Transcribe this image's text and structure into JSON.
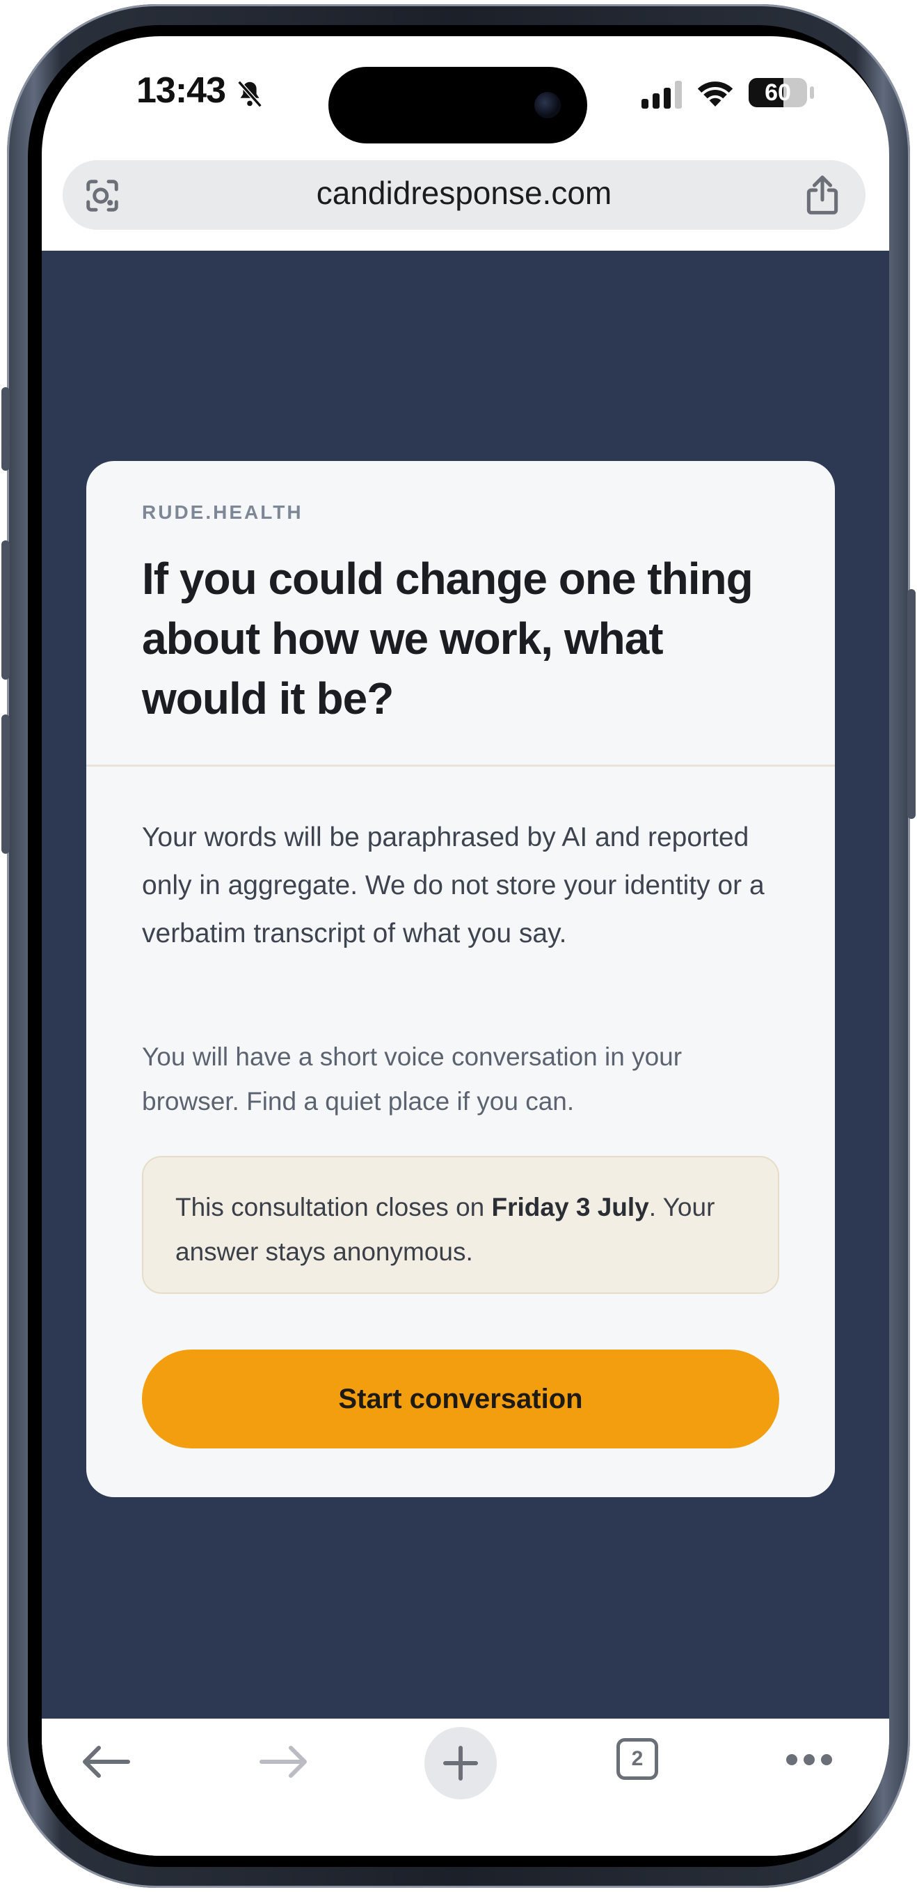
{
  "status_bar": {
    "time": "13:43",
    "battery_level": "60",
    "battery_fraction": 0.6,
    "icons": [
      "bell-slash-icon",
      "cellular-signal-icon",
      "wifi-icon",
      "battery-icon"
    ]
  },
  "browser": {
    "url": "candidresponse.com",
    "icons": [
      "visual-search-icon",
      "share-icon"
    ]
  },
  "card": {
    "brand": "RUDE.HEALTH",
    "question": "If you could change one thing about how we work, what would it be?",
    "privacy_text": "Your words will be paraphrased by AI and reported only in aggregate. We do not store your identity or a verbatim transcript of what you say.",
    "info_text": "You will have a short voice conversation in your browser. Find a quiet place if you can.",
    "notice": {
      "prefix": "This consultation closes on ",
      "date": "Friday 3 July",
      "suffix": ". Your answer stays anonymous."
    },
    "start_button_label": "Start conversation"
  },
  "toolbar": {
    "tab_count": "2",
    "icons": [
      "back-arrow-icon",
      "forward-arrow-icon",
      "new-tab-plus-icon",
      "tabs-icon",
      "more-icon"
    ]
  },
  "colors": {
    "page_background": "#2d3953",
    "card_background": "#f6f7f9",
    "accent": "#f39e0e",
    "notice_background": "#f2eee4"
  }
}
